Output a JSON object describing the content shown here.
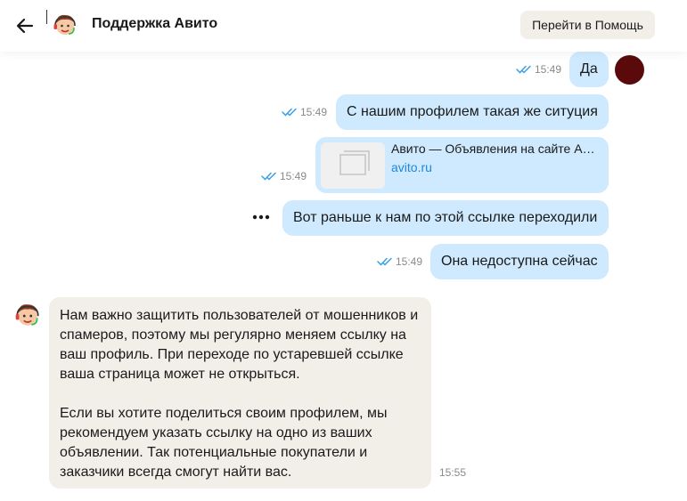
{
  "header": {
    "title": "Поддержка Авито",
    "help_button": "Перейти в Помощь"
  },
  "messages": [
    {
      "type": "outgoing",
      "text": "Да",
      "time": "15:49",
      "status": "read"
    },
    {
      "type": "outgoing",
      "text": "С нашим профилем такая же ситуция",
      "time": "15:49",
      "status": "read"
    },
    {
      "type": "outgoing_link",
      "link_title": "Авито — Объявления на сайте А…",
      "link_url": "avito.ru",
      "time": "15:49",
      "status": "read"
    },
    {
      "type": "outgoing",
      "text": "Вот раньше к нам по этой ссылке переходили",
      "status": "sending"
    },
    {
      "type": "outgoing",
      "text": "Она недоступна сейчас",
      "time": "15:49",
      "status": "read"
    },
    {
      "type": "incoming",
      "paragraph1": "Нам важно защитить пользователей от мошенников и спамеров, поэтому мы регулярно меняем ссылку на ваш профиль. При переходе по устаревшей ссылке ваша страница может не открыться.",
      "paragraph2": "Если вы хотите поделиться своим профилем, мы рекомендуем указать ссылку на одно из ваших объявлении. Так потенциальные покупатели и заказчики всегда смогут найти вас.",
      "time": "15:55"
    }
  ],
  "colors": {
    "outgoing_bubble": "#cfeaff",
    "incoming_bubble": "#f2efe9",
    "read_check": "#3aa0e6",
    "link": "#1f88d6"
  },
  "icons": [
    "back-arrow-icon",
    "support-agent-icon",
    "double-check-icon",
    "more-dots-icon",
    "link-preview-placeholder-icon"
  ]
}
